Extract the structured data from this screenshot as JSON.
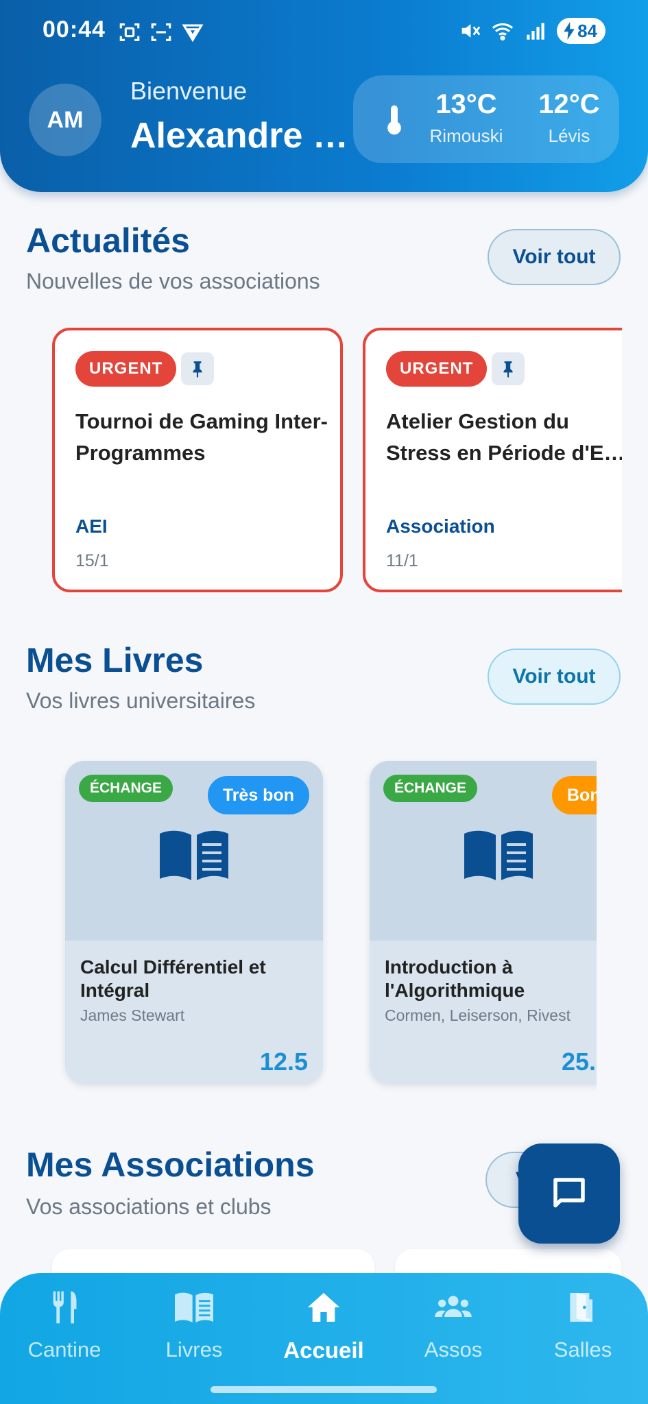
{
  "status_bar": {
    "time": "00:44",
    "battery": "84"
  },
  "header": {
    "avatar_initials": "AM",
    "welcome": "Bienvenue",
    "username": "Alexandre …",
    "weather": [
      {
        "temp": "13°C",
        "city": "Rimouski"
      },
      {
        "temp": "12°C",
        "city": "Lévis"
      }
    ]
  },
  "news": {
    "title": "Actualités",
    "subtitle": "Nouvelles de vos associations",
    "see_all": "Voir tout",
    "cards": [
      {
        "badge": "URGENT",
        "title": "Tournoi de Gaming Inter-Programmes",
        "association": "AEI",
        "date": "15/1"
      },
      {
        "badge": "URGENT",
        "title": "Atelier Gestion du Stress en Période d'E…",
        "association": "Association",
        "date": "11/1"
      }
    ]
  },
  "books": {
    "title": "Mes Livres",
    "subtitle": "Vos livres universitaires",
    "see_all": "Voir tout",
    "cards": [
      {
        "type": "ÉCHANGE",
        "condition": "Très bon",
        "condition_color": "#2196f3",
        "title": "Calcul Différentiel et Intégral",
        "author": "James Stewart",
        "price": "12.5"
      },
      {
        "type": "ÉCHANGE",
        "condition": "Bon",
        "condition_color": "#ff9800",
        "title": "Introduction à l'Algorithmique",
        "author": "Cormen, Leiserson, Rivest",
        "price": "25."
      }
    ]
  },
  "associations": {
    "title": "Mes Associations",
    "subtitle": "Vos associations et clubs",
    "see_all": "V"
  },
  "fab": {
    "icon": "chat-icon"
  },
  "bottom_nav": {
    "items": [
      {
        "label": "Cantine",
        "icon": "utensils-icon"
      },
      {
        "label": "Livres",
        "icon": "book-icon"
      },
      {
        "label": "Accueil",
        "icon": "home-icon",
        "active": true
      },
      {
        "label": "Assos",
        "icon": "groups-icon"
      },
      {
        "label": "Salles",
        "icon": "door-icon"
      }
    ]
  },
  "colors": {
    "primary": "#0b4f93",
    "accent": "#1c8fd4",
    "urgent": "#e4453a",
    "exchange": "#3aa845"
  }
}
